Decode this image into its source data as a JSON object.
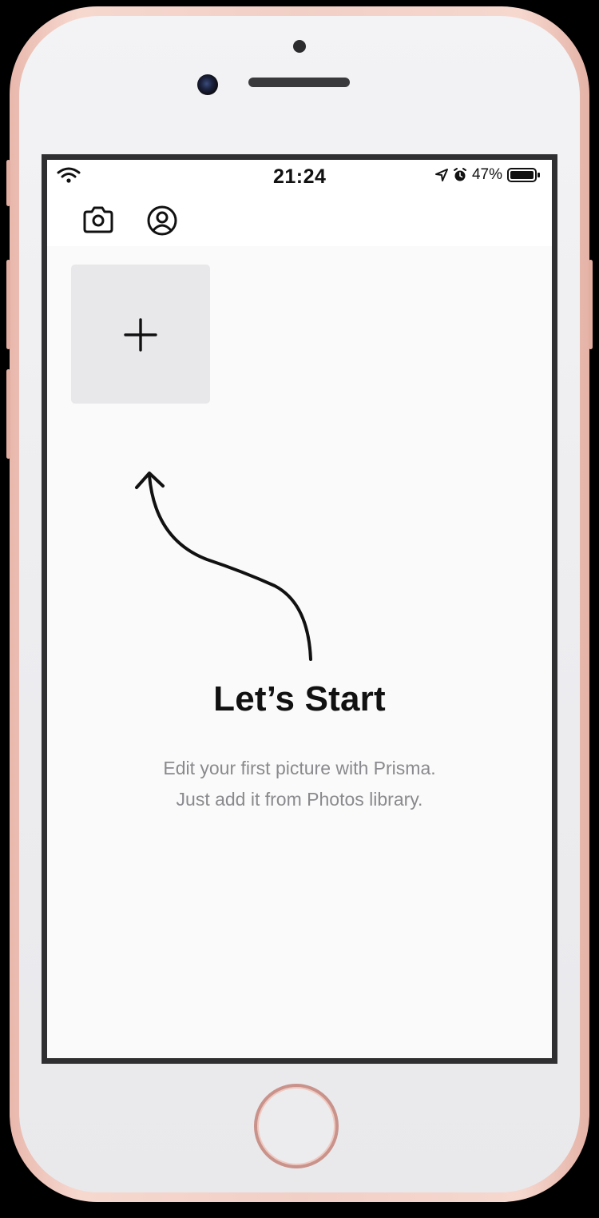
{
  "status_bar": {
    "time": "21:24",
    "battery_percent": "47%",
    "icons": [
      "wifi-icon",
      "location-arrow-icon",
      "alarm-icon",
      "battery-icon"
    ]
  },
  "header": {
    "icons": [
      "camera-icon",
      "profile-icon"
    ]
  },
  "gallery": {
    "add_tile_icon": "plus-icon"
  },
  "empty_state": {
    "title": "Let’s Start",
    "line1": "Edit your first picture with Prisma.",
    "line2": "Just add it from Photos library.",
    "decoration": "curved-arrow-icon"
  },
  "colors": {
    "screen_background": "#fafafa",
    "tile_background": "#e8e8ea",
    "title_text": "#111111",
    "subtitle_text": "#8a8a8e",
    "device_frame": "#f1cfc6"
  }
}
